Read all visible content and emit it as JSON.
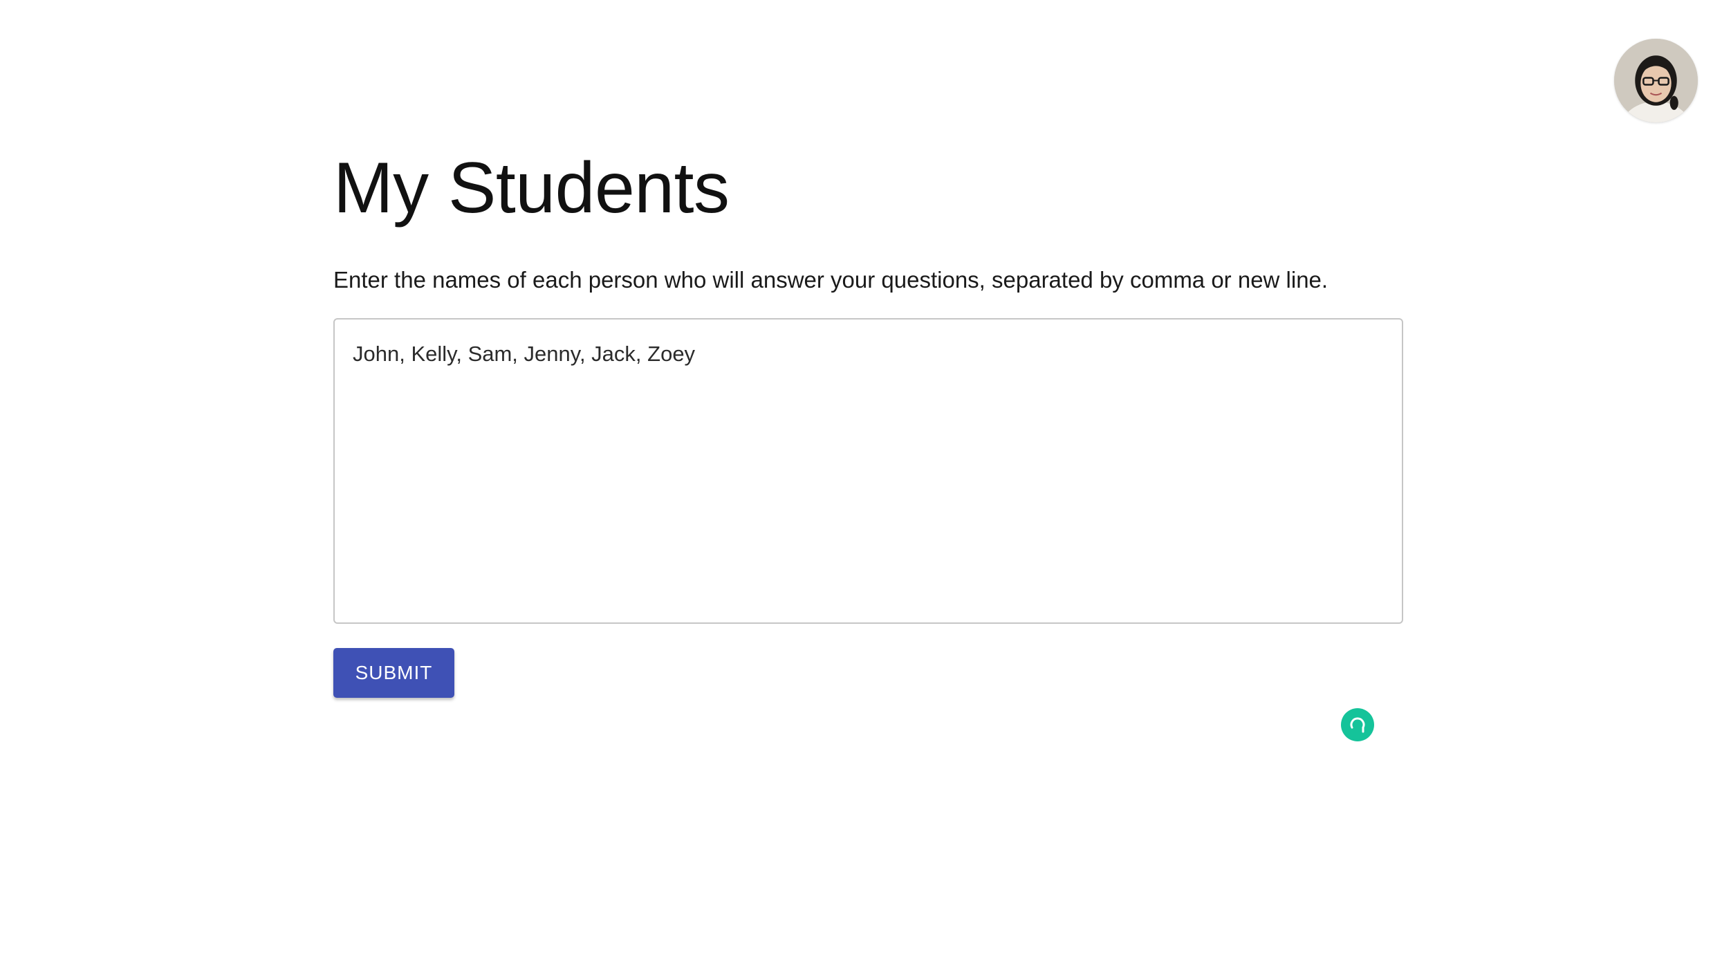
{
  "page": {
    "title": "My Students",
    "instructions": "Enter the names of each person who will answer your questions, separated by comma or new line."
  },
  "students_input": {
    "value": "John, Kelly, Sam, Jenny, Jack, Zoey"
  },
  "actions": {
    "submit_label": "SUBMIT"
  },
  "icons": {
    "avatar": "user-avatar",
    "grammar_badge": "grammar-assistant-icon"
  },
  "colors": {
    "primary": "#3f51b5",
    "grammar_badge": "#15c39a"
  }
}
